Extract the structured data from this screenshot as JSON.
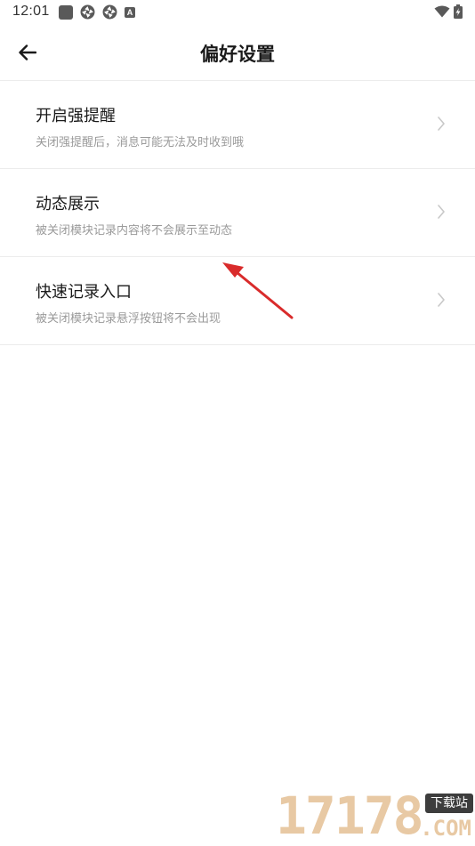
{
  "status_bar": {
    "time": "12:01"
  },
  "header": {
    "title": "偏好设置",
    "back_icon": "arrow-left-icon"
  },
  "settings": [
    {
      "title": "开启强提醒",
      "description": "关闭强提醒后，消息可能无法及时收到哦"
    },
    {
      "title": "动态展示",
      "description": "被关闭模块记录内容将不会展示至动态"
    },
    {
      "title": "快速记录入口",
      "description": "被关闭模块记录悬浮按钮将不会出现"
    }
  ],
  "annotation": {
    "arrow_color": "#d92b2b"
  },
  "watermark": {
    "digits": "17178",
    "badge": "下载站",
    "domain": ".COM"
  },
  "colors": {
    "background": "#ffffff",
    "divider": "#ececec",
    "title_text": "#1a1a1a",
    "desc_text": "#9a9a9a",
    "chevron": "#c8c8c8"
  }
}
